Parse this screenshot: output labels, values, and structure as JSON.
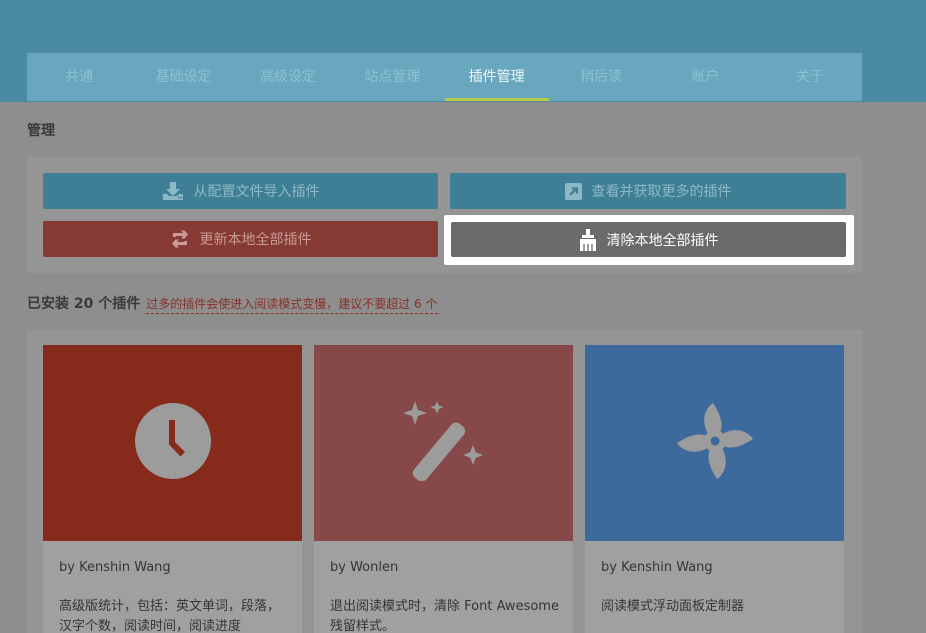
{
  "colors": {
    "topbar": "#4a8aa3",
    "tab_active_underline": "#b9c94a",
    "btn_blue": "#3e7f95",
    "btn_red": "#853a33",
    "btn_clear": "#6a6a6a",
    "card1_banner": "#862a1c",
    "card2_banner": "#864849",
    "card3_banner": "#3d6a9d"
  },
  "nav": {
    "tabs": [
      {
        "label": "共通",
        "active": false
      },
      {
        "label": "基础设定",
        "active": false
      },
      {
        "label": "高级设定",
        "active": false
      },
      {
        "label": "站点管理",
        "active": false
      },
      {
        "label": "插件管理",
        "active": true
      },
      {
        "label": "稍后读",
        "active": false
      },
      {
        "label": "账户",
        "active": false
      },
      {
        "label": "关于",
        "active": false
      }
    ]
  },
  "manage": {
    "title": "管理",
    "import_label": "从配置文件导入插件",
    "more_label": "查看并获取更多的插件",
    "update_label": "更新本地全部插件",
    "clear_label": "清除本地全部插件",
    "import_icon": "download-icon",
    "more_icon": "external-link-icon",
    "update_icon": "refresh-icon",
    "clear_icon": "broom-icon"
  },
  "installed": {
    "count_text": "已安装 20 个插件",
    "warning_text": "过多的插件会使进入阅读模式变慢，建议不要超过 6 个"
  },
  "plugins": [
    {
      "icon": "clock-icon",
      "author": "by Kenshin Wang",
      "description": "高级版统计，包括：英文单词，段落，汉字个数，阅读时间，阅读进度"
    },
    {
      "icon": "magic-wand-icon",
      "author": "by Wonlen",
      "description": "退出阅读模式时，清除 Font Awesome 残留样式。"
    },
    {
      "icon": "fan-icon",
      "author": "by Kenshin Wang",
      "description": "阅读模式浮动面板定制器"
    }
  ]
}
